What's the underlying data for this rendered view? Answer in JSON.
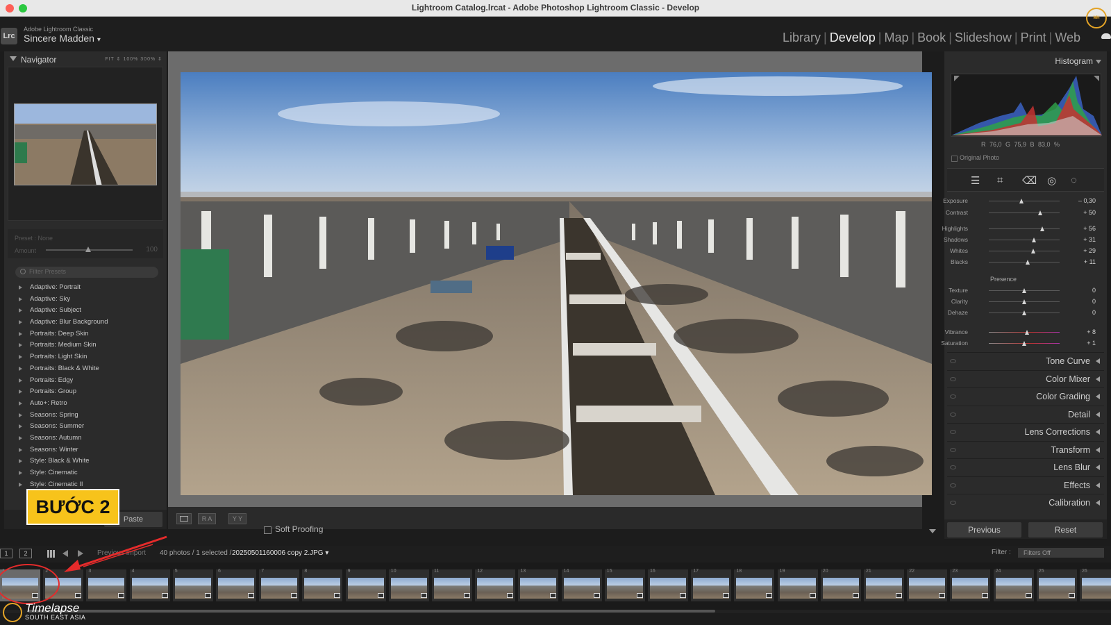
{
  "window": {
    "title": "Lightroom Catalog.lrcat - Adobe Photoshop Lightroom Classic - Develop"
  },
  "identity": {
    "logo": "Lrc",
    "app_name": "Adobe Lightroom Classic",
    "user": "Sincere Madden",
    "user_menu_icon": "▾"
  },
  "modules": [
    {
      "label": "Library",
      "active": false
    },
    {
      "label": "Develop",
      "active": true
    },
    {
      "label": "Map",
      "active": false
    },
    {
      "label": "Book",
      "active": false
    },
    {
      "label": "Slideshow",
      "active": false
    },
    {
      "label": "Print",
      "active": false
    },
    {
      "label": "Web",
      "active": false
    }
  ],
  "navigator": {
    "title": "Navigator",
    "zoom": "FIT ⇕   100%   300%  ⇕"
  },
  "preset_amount": {
    "preset_label": "Preset : None",
    "amount_label": "Amount",
    "amount_value": "100",
    "amount_fraction": 0.62
  },
  "presets": {
    "filter_placeholder": "Filter Presets",
    "items": [
      "Adaptive: Portrait",
      "Adaptive: Sky",
      "Adaptive: Subject",
      "Adaptive: Blur Background",
      "Portraits: Deep Skin",
      "Portraits: Medium Skin",
      "Portraits: Light Skin",
      "Portraits: Black & White",
      "Portraits: Edgy",
      "Portraits: Group",
      "Auto+: Retro",
      "Seasons: Spring",
      "Seasons: Summer",
      "Seasons: Autumn",
      "Seasons: Winter",
      "Style: Black & White",
      "Style: Cinematic",
      "Style: Cinematic II"
    ]
  },
  "left_bottom": {
    "paste_label": "Paste"
  },
  "annotation": {
    "step_label": "BƯỚC 2"
  },
  "toolbar": {
    "view1": "",
    "view2": "R A",
    "view3": "Y Y",
    "soft_proofing": "Soft Proofing"
  },
  "histogram": {
    "title": "Histogram",
    "rgb_readout": "R  76,0  G  75,9  B  83,0 %",
    "original_photo": "Original Photo"
  },
  "tools": [
    "sliders-icon",
    "crop-icon",
    "eraser-icon",
    "redeye-icon",
    "mask-icon"
  ],
  "basic_sliders": [
    {
      "label": "Exposure",
      "value": "– 0,30",
      "fraction": 0.47
    },
    {
      "label": "Contrast",
      "value": "+ 50",
      "fraction": 0.73
    },
    {
      "label": "Highlights",
      "value": "+ 56",
      "fraction": 0.76
    },
    {
      "label": "Shadows",
      "value": "+ 31",
      "fraction": 0.64
    },
    {
      "label": "Whites",
      "value": "+ 29",
      "fraction": 0.63
    },
    {
      "label": "Blacks",
      "value": "+ 11",
      "fraction": 0.55
    }
  ],
  "presence": {
    "label": "Presence",
    "sliders": [
      {
        "label": "Texture",
        "value": "0",
        "fraction": 0.5
      },
      {
        "label": "Clarity",
        "value": "0",
        "fraction": 0.5
      },
      {
        "label": "Dehaze",
        "value": "0",
        "fraction": 0.5
      },
      {
        "label": "Vibrance",
        "value": "+ 8",
        "fraction": 0.54
      },
      {
        "label": "Saturation",
        "value": "+ 1",
        "fraction": 0.5
      }
    ]
  },
  "sections": [
    "Tone Curve",
    "Color Mixer",
    "Color Grading",
    "Detail",
    "Lens Corrections",
    "Transform",
    "Lens Blur",
    "Effects",
    "Calibration"
  ],
  "right_bottom": {
    "previous": "Previous",
    "reset": "Reset"
  },
  "filmbar": {
    "page1": "1",
    "page2": "2",
    "source": "Previous Import",
    "count": "40 photos / 1 selected /",
    "filename": "20250501160006 copy 2.JPG ▾",
    "filter_label": "Filter :",
    "filter_value": "Filters Off"
  },
  "filmstrip": {
    "numbers": [
      "1",
      "2",
      "3",
      "4",
      "5",
      "6",
      "7",
      "8",
      "9",
      "10",
      "11",
      "12",
      "13",
      "14",
      "15",
      "16",
      "17",
      "18",
      "19",
      "20",
      "21",
      "22",
      "23",
      "24",
      "25",
      "26"
    ],
    "selected_index": 0
  },
  "watermark": {
    "line1": "Timelapse",
    "line2": "SOUTH EAST ASIA"
  },
  "colors": {
    "accent": "#f7c31b",
    "red": "#e52b2b",
    "badge": "#e3a326"
  }
}
